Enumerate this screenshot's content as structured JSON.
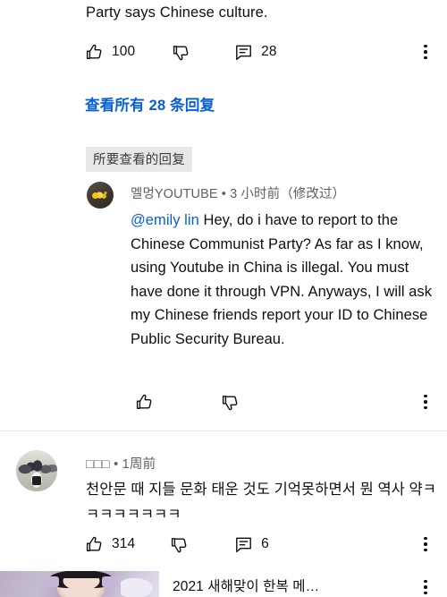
{
  "top_comment": {
    "text_tail": "Party says Chinese culture.",
    "like_count": "100",
    "reply_count": "28",
    "like_icon": "thumbs-up-icon",
    "dislike_icon": "thumbs-down-icon",
    "comment_icon": "comment-bubble-icon",
    "more_icon": "kebab-menu-icon",
    "view_replies_label": "查看所有 28 条回复"
  },
  "highlighted_reply": {
    "chip_label": "所要查看的回复",
    "author": "멜멍YOUTUBE",
    "separator": "•",
    "timestamp": "3 小时前",
    "edited_label": "（修改过）",
    "meta_line": "멜멍YOUTUBE • 3 小时前（修改过）",
    "mention": "@emily lin",
    "body": " Hey, do i have to report to the Chinese Communist Party? As far as I know, using Youtube in China is illegal. You must have done it through VPN. Anyways, I will ask my Chinese friends report your ID to Chinese Public Security Bureau.",
    "like_count": "",
    "like_icon": "thumbs-up-icon",
    "dislike_icon": "thumbs-down-icon",
    "more_icon": "kebab-menu-icon",
    "avatar": "user-avatar-dark-gold"
  },
  "comment_2": {
    "author": "□□□",
    "separator": "•",
    "timestamp": "1周前",
    "meta_line": "□□□ • 1周前",
    "body": "천안문 때 지들 문화 태운 것도 기억못하면서 뭔 역사 약ㅋㅋㅋㅋㅋㅋㅋㅋ",
    "like_count": "314",
    "reply_count": "6",
    "like_icon": "thumbs-up-icon",
    "dislike_icon": "thumbs-down-icon",
    "comment_icon": "comment-bubble-icon",
    "more_icon": "kebab-menu-icon",
    "avatar": "user-avatar-photo-crowd"
  },
  "video_card": {
    "title": "2021 새해맞이 한복 메…",
    "more_icon": "kebab-menu-icon",
    "thumbnail": "video-thumbnail-person-headphones"
  },
  "colors": {
    "link": "#065fd4",
    "text_primary": "#0f0f0f",
    "text_secondary": "#606060",
    "chip_bg": "#e8e8e8",
    "divider": "#e5e5e5",
    "background": "#ffffff"
  }
}
